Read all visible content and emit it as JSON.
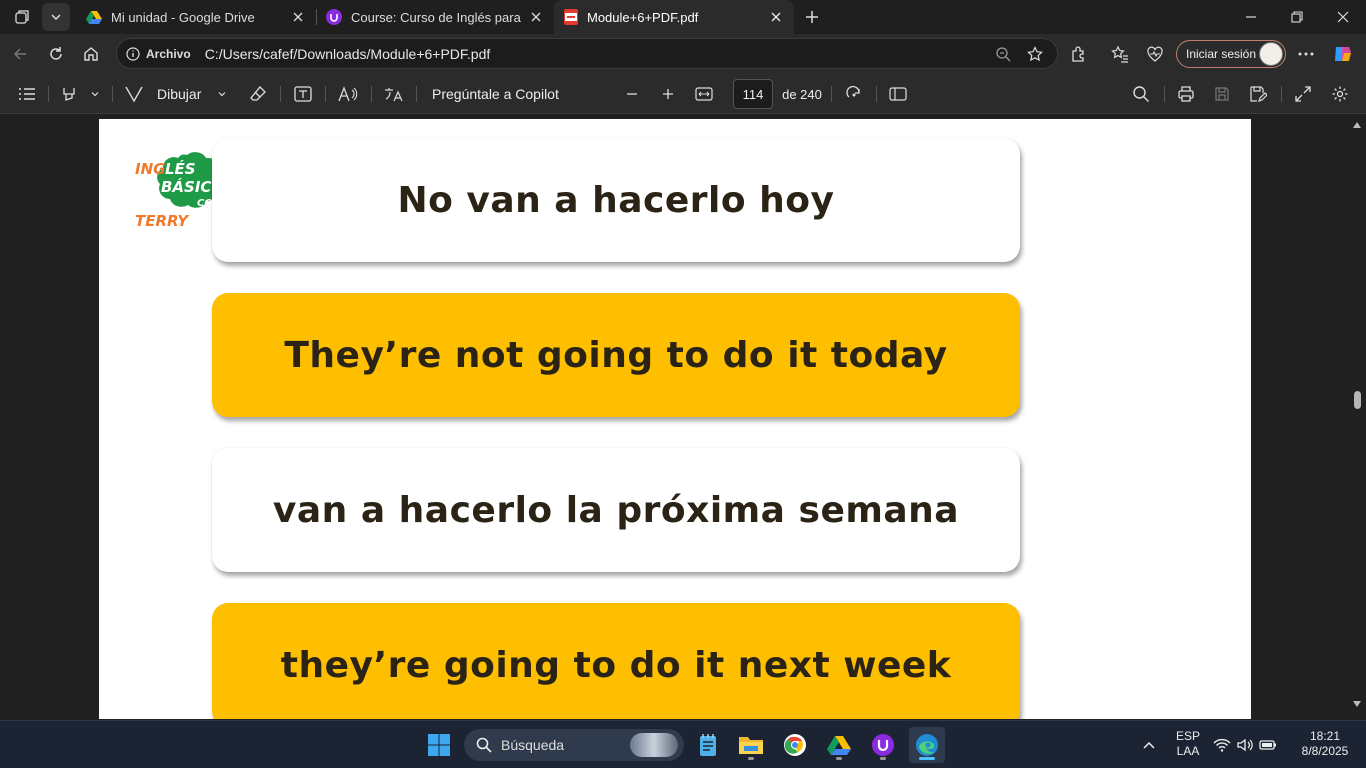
{
  "browser": {
    "tabs": [
      {
        "title": "Mi unidad - Google Drive",
        "active": false
      },
      {
        "title": "Course: Curso de Inglés para principiantes",
        "active": false
      },
      {
        "title": "Module+6+PDF.pdf",
        "active": true
      }
    ],
    "address": {
      "security_label": "Archivo",
      "url": "C:/Users/cafef/Downloads/Module+6+PDF.pdf"
    },
    "signin_label": "Iniciar sesión"
  },
  "pdf_toolbar": {
    "draw_label": "Dibujar",
    "copilot_label": "Pregúntale a Copilot",
    "page_current": "114",
    "page_total_label": "de 240"
  },
  "document": {
    "logo_text": {
      "line1": "INGLÉS",
      "line2": "BÁSICO",
      "line3": "CON",
      "line4": "TERRY"
    },
    "cards": [
      {
        "text": "No van a hacerlo hoy",
        "style": "white"
      },
      {
        "text": "They’re not going to do it today",
        "style": "yellow"
      },
      {
        "text": "van a hacerlo la próxima semana",
        "style": "white"
      },
      {
        "text": "they’re going to do it next week",
        "style": "yellow"
      }
    ],
    "colors": {
      "card_yellow": "#fdbf00",
      "text_dark": "#2b2416",
      "logo_green": "#1f9a47",
      "logo_orange": "#f07a2c"
    }
  },
  "taskbar": {
    "search_placeholder": "Búsqueda",
    "language": "ESP",
    "layout": "LAA",
    "time": "18:21",
    "date": "8/8/2025"
  }
}
